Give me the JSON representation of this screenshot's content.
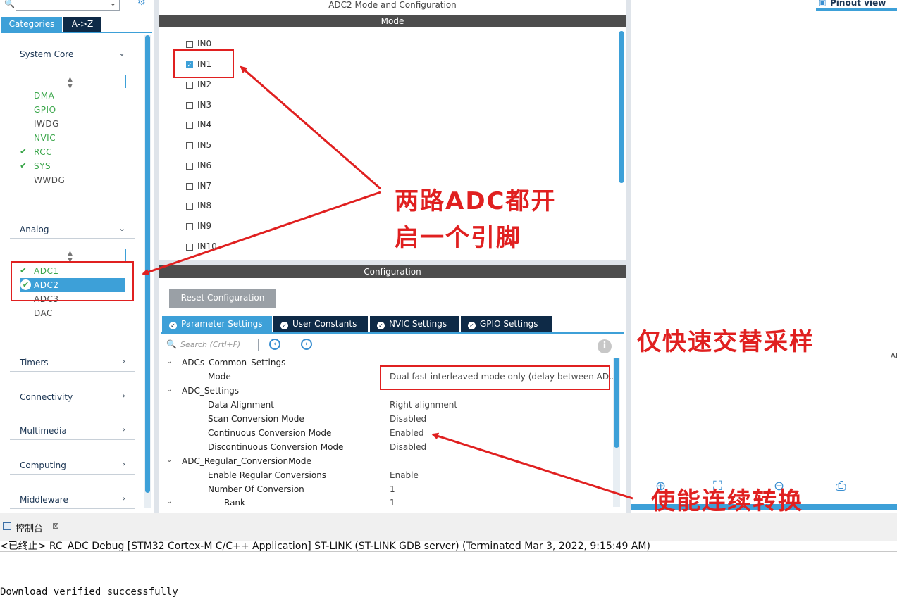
{
  "left": {
    "tabs": [
      {
        "label": "Categories"
      },
      {
        "label": "A->Z"
      }
    ],
    "sections": [
      {
        "label": "System Core"
      },
      {
        "label": "Analog"
      },
      {
        "label": "Timers"
      },
      {
        "label": "Connectivity"
      },
      {
        "label": "Multimedia"
      },
      {
        "label": "Computing"
      },
      {
        "label": "Middleware"
      }
    ],
    "system_core_items": [
      {
        "label": "DMA",
        "checked": false,
        "color": "green"
      },
      {
        "label": "GPIO",
        "checked": false,
        "color": "green"
      },
      {
        "label": "IWDG",
        "checked": false,
        "color": "gray"
      },
      {
        "label": "NVIC",
        "checked": false,
        "color": "green"
      },
      {
        "label": "RCC",
        "checked": true,
        "color": "green"
      },
      {
        "label": "SYS",
        "checked": true,
        "color": "green"
      },
      {
        "label": "WWDG",
        "checked": false,
        "color": "gray"
      }
    ],
    "analog_items": [
      {
        "label": "ADC1",
        "checked": true
      },
      {
        "label": "ADC2",
        "checked": true,
        "selected": true
      },
      {
        "label": "ADC3",
        "checked": false
      },
      {
        "label": "DAC",
        "checked": false
      }
    ]
  },
  "middle": {
    "title": "ADC2 Mode and Configuration",
    "mode_header": "Mode",
    "inputs": [
      {
        "label": "IN0",
        "checked": false
      },
      {
        "label": "IN1",
        "checked": true
      },
      {
        "label": "IN2",
        "checked": false
      },
      {
        "label": "IN3",
        "checked": false
      },
      {
        "label": "IN4",
        "checked": false
      },
      {
        "label": "IN5",
        "checked": false
      },
      {
        "label": "IN6",
        "checked": false
      },
      {
        "label": "IN7",
        "checked": false
      },
      {
        "label": "IN8",
        "checked": false
      },
      {
        "label": "IN9",
        "checked": false
      },
      {
        "label": "IN10",
        "checked": false
      }
    ],
    "config_header": "Configuration",
    "reset_label": "Reset Configuration",
    "param_tabs": [
      {
        "label": "Parameter Settings"
      },
      {
        "label": "User Constants"
      },
      {
        "label": "NVIC Settings"
      },
      {
        "label": "GPIO Settings"
      }
    ],
    "search_placeholder": "Search (Crtl+F)",
    "tree": [
      {
        "kind": "group",
        "label": "ADCs_Common_Settings"
      },
      {
        "kind": "param",
        "label": "Mode",
        "value": "Dual fast interleaved mode only (delay between AD..."
      },
      {
        "kind": "group",
        "label": "ADC_Settings"
      },
      {
        "kind": "param",
        "label": "Data Alignment",
        "value": "Right alignment"
      },
      {
        "kind": "param",
        "label": "Scan Conversion Mode",
        "value": "Disabled"
      },
      {
        "kind": "param",
        "label": "Continuous Conversion Mode",
        "value": "Enabled"
      },
      {
        "kind": "param",
        "label": "Discontinuous Conversion Mode",
        "value": "Disabled"
      },
      {
        "kind": "group",
        "label": "ADC_Regular_ConversionMode"
      },
      {
        "kind": "param",
        "label": "Enable Regular Conversions",
        "value": "Enable"
      },
      {
        "kind": "param",
        "label": "Number Of Conversion",
        "value": "1"
      },
      {
        "kind": "subparam",
        "label": "Rank",
        "value": "1"
      }
    ]
  },
  "right": {
    "pinout_label": "Pinout view",
    "edge_text": "AI"
  },
  "console": {
    "tab_title": "控制台",
    "close_glyph": "⊠",
    "status": "<已终止> RC_ADC Debug [STM32 Cortex-M C/C++ Application] ST-LINK (ST-LINK GDB server) (Terminated Mar 3, 2022, 9:15:49 AM)",
    "output": "Download verified successfully"
  },
  "annotations": {
    "label1_line1": "两路ADC都开",
    "label1_line2": "启一个引脚",
    "label2": "仅快速交替采样",
    "label3": "使能连续转换",
    "color": "#e02020"
  }
}
